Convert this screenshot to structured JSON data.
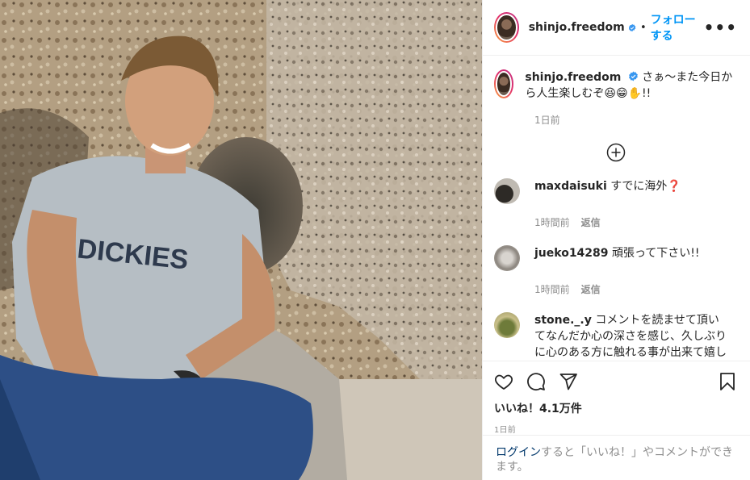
{
  "header": {
    "username": "shinjo.freedom",
    "separator": "•",
    "follow_label": "フォローする",
    "more_label": "•••"
  },
  "caption": {
    "username": "shinjo.freedom",
    "text": "さぁ〜また今日から人生楽しむぞ😆😁✋!!",
    "time": "1日前"
  },
  "comments": [
    {
      "username": "maxdaisuki",
      "text": "すでに海外❓",
      "time": "1時間前",
      "reply": "返信"
    },
    {
      "username": "jueko14289",
      "text": "頑張って下さい!!",
      "time": "1時間前",
      "reply": "返信"
    },
    {
      "username": "stone._.y",
      "text": "コメントを読ませて頂いてなんだか心の深さを感じ、久しぶりに心のある方に触れる事が出来て嬉しかったです🙏",
      "time": "",
      "reply": ""
    }
  ],
  "footer": {
    "likes": "いいね！4.1万件",
    "time": "1日前",
    "login_link": "ログイン",
    "login_text": "すると「いいね！」やコメントができます。"
  },
  "colors": {
    "accent": "#0095f6",
    "verified": "#3897f0",
    "muted": "#8e8e8e"
  }
}
